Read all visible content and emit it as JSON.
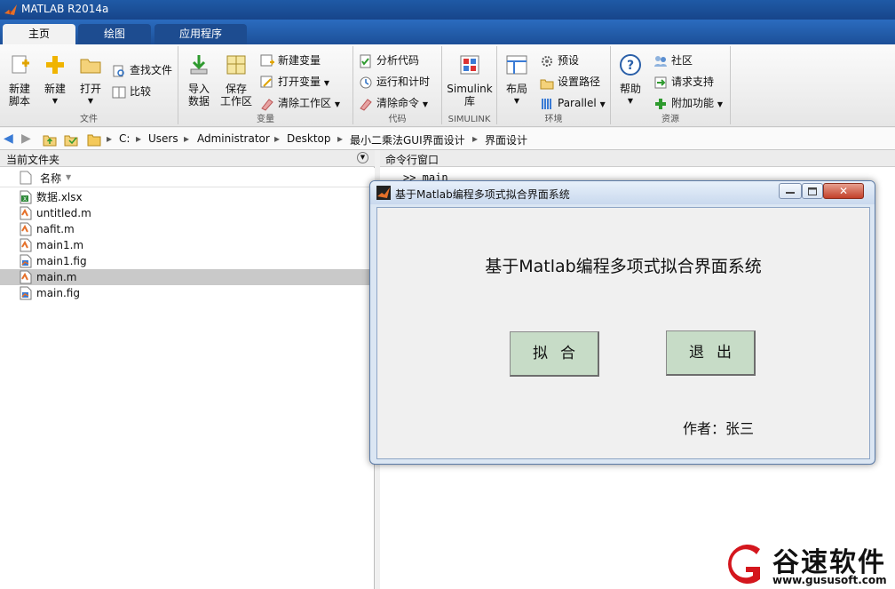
{
  "window": {
    "title": "MATLAB R2014a"
  },
  "tabs": [
    {
      "label": "主页",
      "active": true
    },
    {
      "label": "绘图",
      "active": false
    },
    {
      "label": "应用程序",
      "active": false
    }
  ],
  "ribbon": {
    "file": {
      "label": "文件",
      "new_script": "新建\n脚本",
      "new": "新建",
      "open": "打开",
      "find_files": "查找文件",
      "compare": "比较"
    },
    "variable": {
      "label": "变量",
      "import": "导入\n数据",
      "save": "保存\n工作区",
      "new_var": "新建变量",
      "open_var": "打开变量",
      "clear_ws": "清除工作区"
    },
    "code": {
      "label": "代码",
      "analyze": "分析代码",
      "run_time": "运行和计时",
      "clear_cmd": "清除命令"
    },
    "simulink": {
      "label": "SIMULINK",
      "lib": "Simulink\n库"
    },
    "environment": {
      "label": "环境",
      "layout": "布局",
      "prefs": "预设",
      "set_path": "设置路径",
      "parallel": "Parallel"
    },
    "resources": {
      "label": "资源",
      "help": "帮助",
      "community": "社区",
      "support": "请求支持",
      "addons": "附加功能"
    }
  },
  "address": {
    "crumbs": [
      "C:",
      "Users",
      "Administrator",
      "Desktop",
      "最小二乘法GUI界面设计",
      "界面设计"
    ]
  },
  "current_folder": {
    "title": "当前文件夹",
    "column": "名称",
    "files": [
      {
        "name": "数据.xlsx",
        "type": "xlsx",
        "selected": false
      },
      {
        "name": "untitled.m",
        "type": "m",
        "selected": false
      },
      {
        "name": "nafit.m",
        "type": "m",
        "selected": false
      },
      {
        "name": "main1.m",
        "type": "m",
        "selected": false
      },
      {
        "name": "main1.fig",
        "type": "fig",
        "selected": false
      },
      {
        "name": "main.m",
        "type": "m",
        "selected": true
      },
      {
        "name": "main.fig",
        "type": "fig",
        "selected": false
      }
    ]
  },
  "command_window": {
    "title": "命令行窗口",
    "line": ">> main"
  },
  "figure": {
    "title": "基于Matlab编程多项式拟合界面系统",
    "heading": "基于Matlab编程多项式拟合界面系统",
    "fit_button": "拟合",
    "exit_button": "退出",
    "author": "作者：张三"
  },
  "watermark": {
    "name": "谷速软件",
    "url": "www.gususoft.com"
  }
}
